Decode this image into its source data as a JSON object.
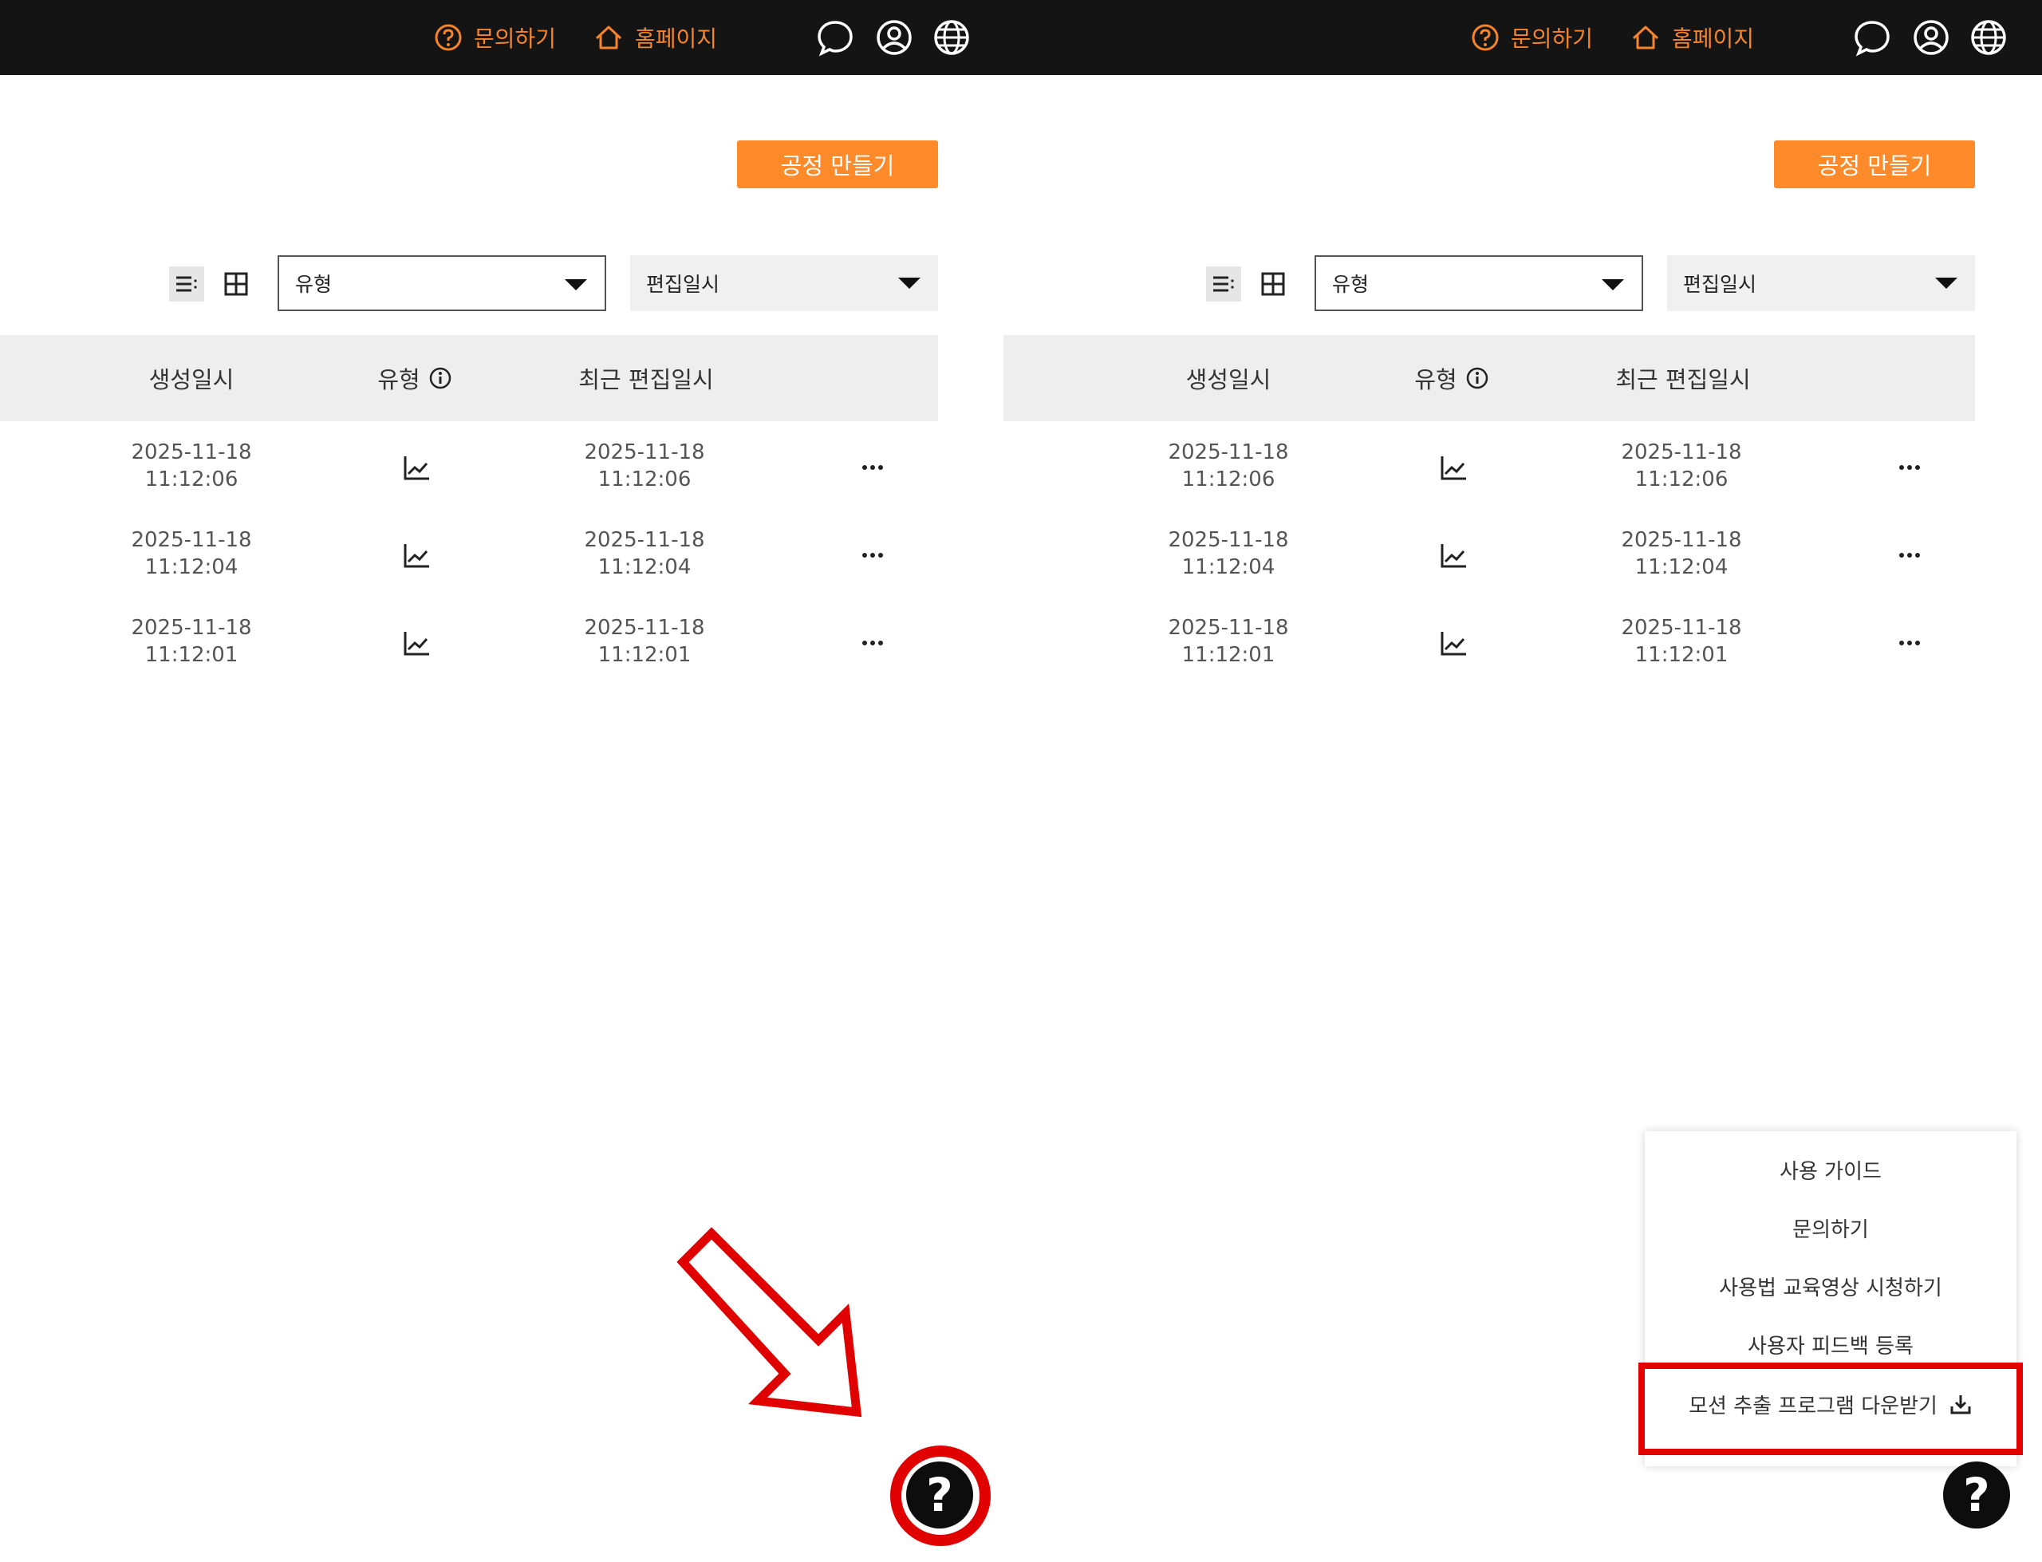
{
  "topbar": {
    "inquiry_label": "문의하기",
    "homepage_label": "홈페이지"
  },
  "toolbar": {
    "create_label": "공정 만들기",
    "type_filter": "유형",
    "sort_value": "편집일시"
  },
  "table": {
    "headers": [
      "생성일시",
      "유형",
      "최근 편집일시"
    ],
    "rows": [
      {
        "created_date": "2025-11-18",
        "created_time": "11:12:06",
        "edited_date": "2025-11-18",
        "edited_time": "11:12:06"
      },
      {
        "created_date": "2025-11-18",
        "created_time": "11:12:04",
        "edited_date": "2025-11-18",
        "edited_time": "11:12:04"
      },
      {
        "created_date": "2025-11-18",
        "created_time": "11:12:01",
        "edited_date": "2025-11-18",
        "edited_time": "11:12:01"
      }
    ]
  },
  "help": {
    "fab_label": "?",
    "menu": [
      "사용 가이드",
      "문의하기",
      "사용법 교육영상 시청하기",
      "사용자 피드백 등록",
      "모션 추출 프로그램 다운받기"
    ]
  },
  "colors": {
    "accent": "#ff8a2a",
    "topbar": "#141414",
    "annotation": "#e10000"
  }
}
